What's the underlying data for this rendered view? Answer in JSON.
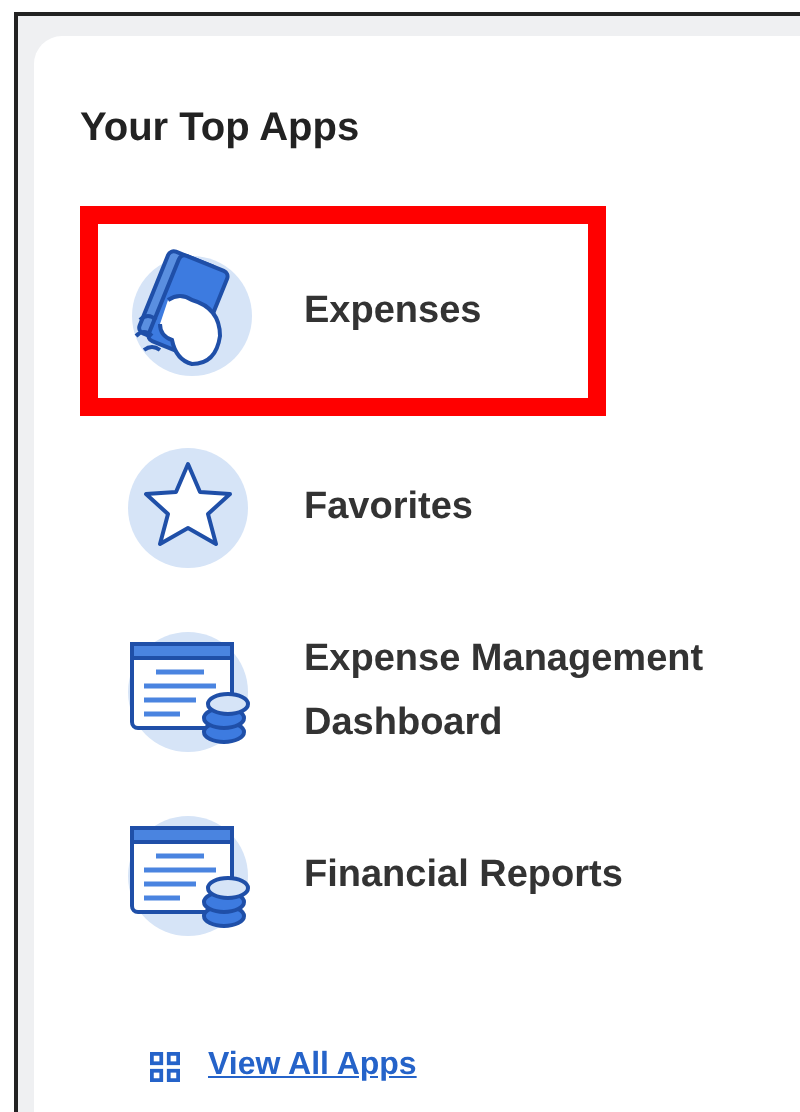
{
  "card": {
    "title": "Your Top Apps",
    "apps": [
      {
        "label": "Expenses",
        "kind": "cash",
        "highlighted": true
      },
      {
        "label": "Favorites",
        "kind": "star",
        "highlighted": false
      },
      {
        "label": "Expense Management Dashboard",
        "kind": "report",
        "highlighted": false
      },
      {
        "label": "Financial Reports",
        "kind": "report",
        "highlighted": false
      }
    ],
    "link": "View All Apps"
  }
}
